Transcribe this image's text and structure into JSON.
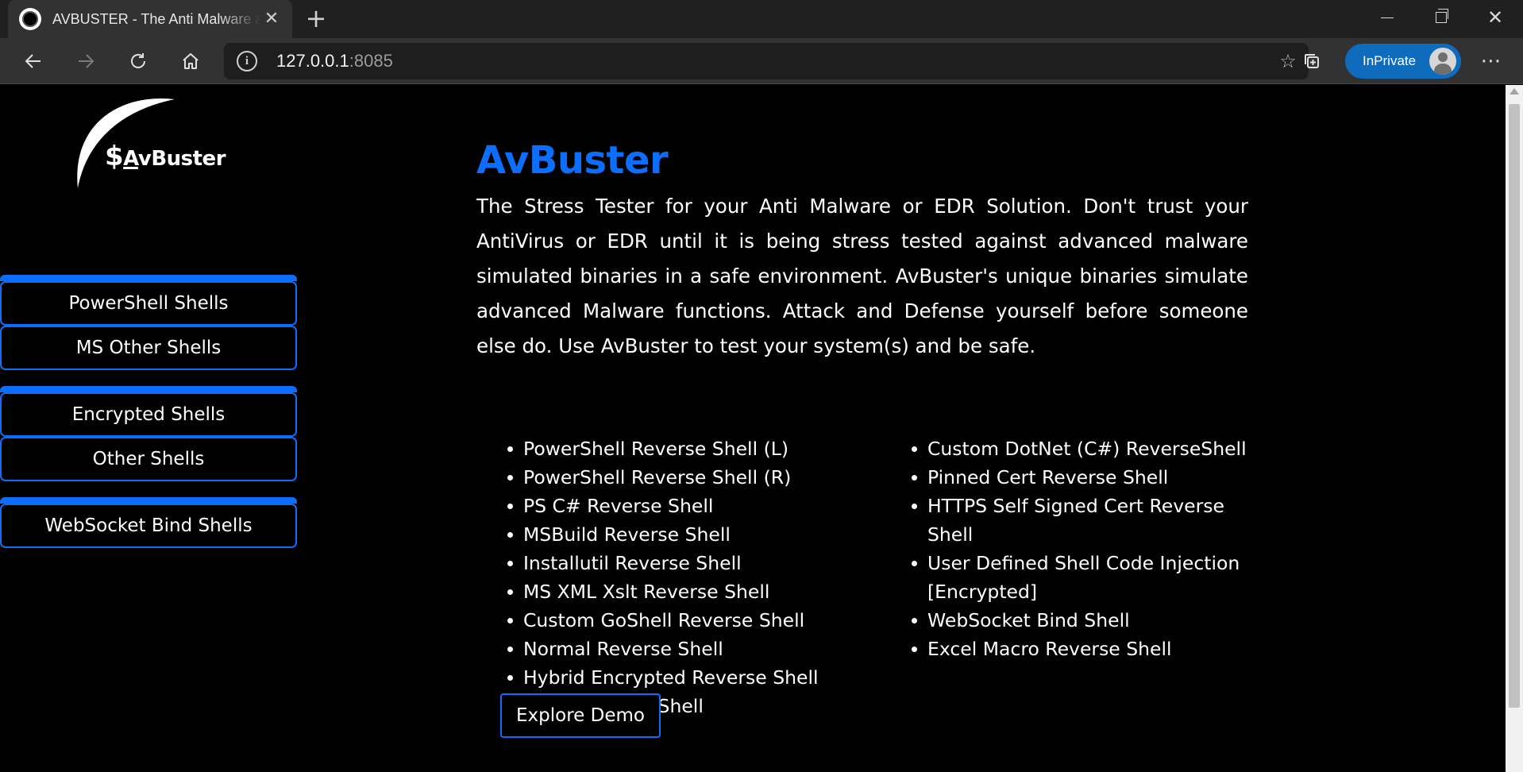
{
  "browser": {
    "tab_title": "AVBUSTER - The Anti Malware and EDR Stress Tester",
    "address_host": "127.0.0.1",
    "address_port": ":8085",
    "profile_label": "InPrivate"
  },
  "logo": {
    "dollar": "$",
    "a": "A",
    "rest": "vBuster"
  },
  "sidebar": {
    "groups": [
      {
        "items": [
          {
            "label": "PowerShell Shells"
          },
          {
            "label": "MS Other Shells"
          }
        ]
      },
      {
        "items": [
          {
            "label": "Encrypted Shells"
          },
          {
            "label": "Other Shells"
          }
        ]
      },
      {
        "items": [
          {
            "label": "WebSocket Bind Shells"
          }
        ]
      }
    ]
  },
  "main": {
    "title": "AvBuster",
    "intro": "The Stress Tester for your Anti Malware or EDR Solution. Don't trust your AntiVirus or EDR until it is being stress tested against advanced malware simulated binaries in a safe environment. AvBuster's unique binaries simulate advanced Malware functions. Attack and Defense yourself before someone else do. Use AvBuster to test your system(s) and be safe.",
    "left_list": [
      "PowerShell Reverse Shell (L)",
      "PowerShell Reverse Shell (R)",
      "PS C# Reverse Shell",
      "MSBuild Reverse Shell",
      "Installutil Reverse Shell",
      "MS XML Xslt Reverse Shell",
      "Custom GoShell Reverse Shell",
      "Normal Reverse Shell",
      "Hybrid Encrypted Reverse Shell",
      "HTTP Reverse Shell"
    ],
    "right_list": [
      "Custom DotNet (C#) ReverseShell",
      "Pinned Cert Reverse Shell",
      "HTTPS Self Signed Cert Reverse Shell",
      "User Defined Shell Code Injection [Encrypted]",
      "WebSocket Bind Shell",
      "Excel Macro Reverse Shell"
    ],
    "demo_button": "Explore Demo"
  },
  "colors": {
    "accent": "#0d6efd",
    "background": "#000000",
    "text": "#ffffff",
    "inprivate": "#0f6cbd"
  }
}
